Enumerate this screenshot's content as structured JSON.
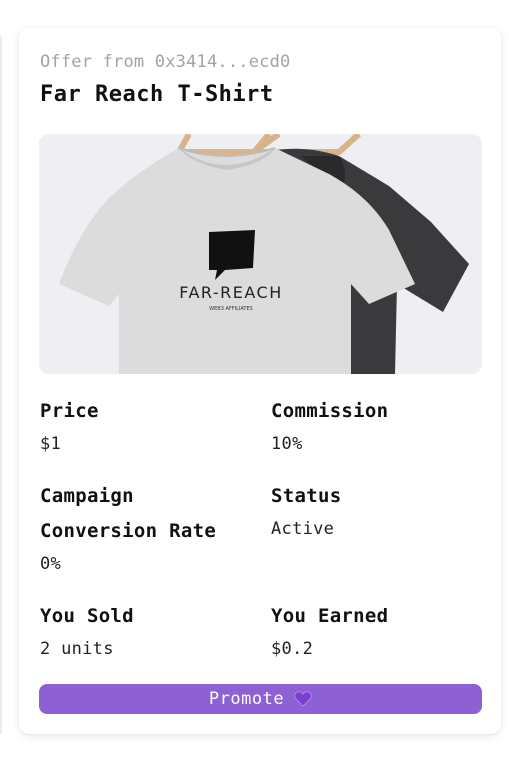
{
  "offer": {
    "from_label": "Offer from 0x3414...ecd0",
    "title": "Far Reach T-Shirt",
    "image": {
      "brand_text": "FAR-REACH",
      "tagline_text": "WEB3 AFFILIATES"
    }
  },
  "stats": {
    "price": {
      "label": "Price",
      "value": "$1"
    },
    "commission": {
      "label": "Commission",
      "value": "10%"
    },
    "conversion": {
      "label_line1": "Campaign",
      "label_line2": "Conversion Rate",
      "value": "0%"
    },
    "status": {
      "label": "Status",
      "value": "Active"
    },
    "sold": {
      "label": "You Sold",
      "value": "2 units"
    },
    "earned": {
      "label": "You Earned",
      "value": "$0.2"
    }
  },
  "actions": {
    "promote_label": "Promote",
    "promote_icon": "purple-heart-icon"
  },
  "colors": {
    "accent": "#8d61d4",
    "muted_text": "#a2a2ab",
    "image_bg": "#efeff3"
  }
}
